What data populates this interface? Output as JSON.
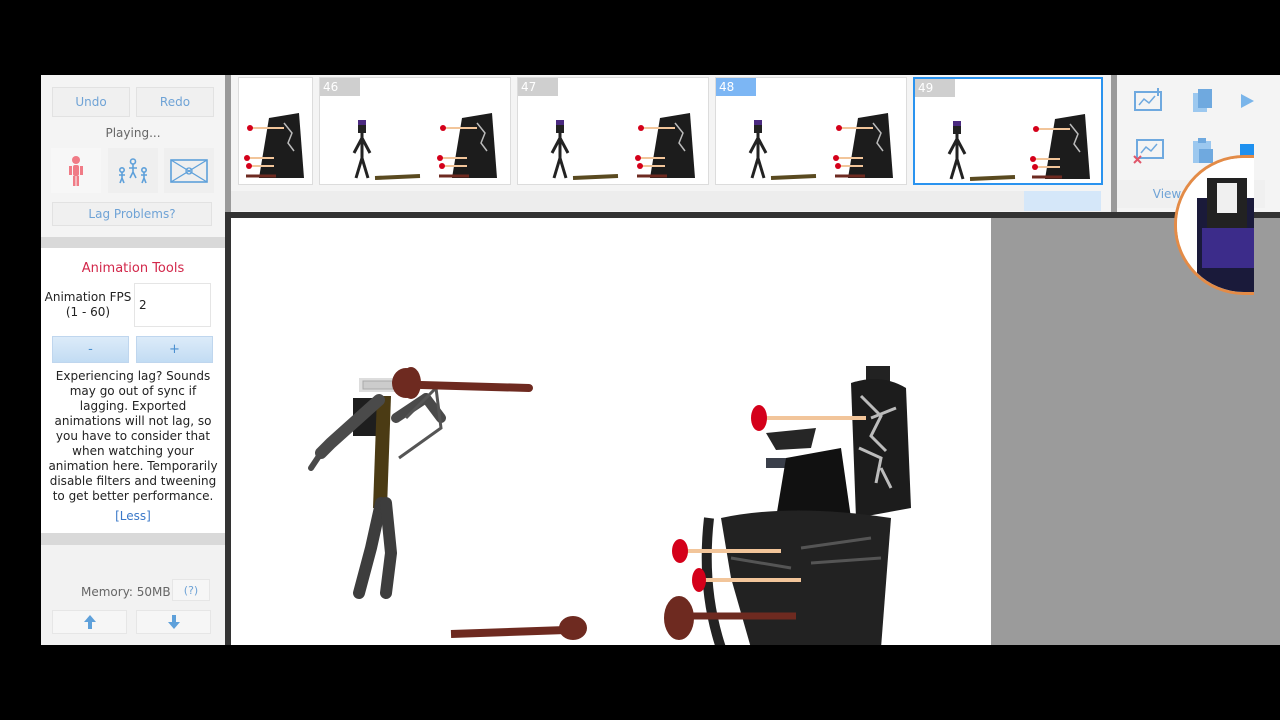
{
  "toolbar": {
    "undo_label": "Undo",
    "redo_label": "Redo",
    "status": "Playing...",
    "lag_problems_label": "Lag Problems?"
  },
  "modes": [
    {
      "name": "figure-mode",
      "icon": "stick-figure-icon"
    },
    {
      "name": "group-mode",
      "icon": "group-figures-icon"
    },
    {
      "name": "scene-mode",
      "icon": "scene-image-icon"
    }
  ],
  "animation_tools": {
    "title": "Animation Tools",
    "fps_label_line1": "Animation FPS",
    "fps_label_line2": "(1 - 60)",
    "fps_value": "2",
    "minus_label": "-",
    "plus_label": "+",
    "lag_text": "Experiencing lag? Sounds may go out of sync if lagging. Exported animations will not lag, so you have to consider that when watching your animation here. Temporarily disable filters and tweening to get better performance.",
    "less_link": "[Less]"
  },
  "bottom": {
    "memory": "Memory: 50MB",
    "help_label": "(?)",
    "up_icon": "arrow-up-icon",
    "down_icon": "arrow-down-icon"
  },
  "timeline": {
    "frames": [
      {
        "number": "",
        "selected": false
      },
      {
        "number": "46",
        "selected": false
      },
      {
        "number": "47",
        "selected": false
      },
      {
        "number": "48",
        "selected": false,
        "highlight": true
      },
      {
        "number": "49",
        "selected": true
      }
    ]
  },
  "controls": {
    "add_frame_icon": "add-frame-icon",
    "copy_frame_icon": "copy-frame-icon",
    "play_icon": "play-icon",
    "delete_frame_icon": "delete-frame-icon",
    "paste_frame_icon": "paste-frame-icon",
    "stop_icon": "stop-icon",
    "view_options_label": "View options"
  },
  "colors": {
    "accent_blue": "#2a93ef",
    "title_red": "#d2274a",
    "link_blue": "#6fa3d6"
  }
}
